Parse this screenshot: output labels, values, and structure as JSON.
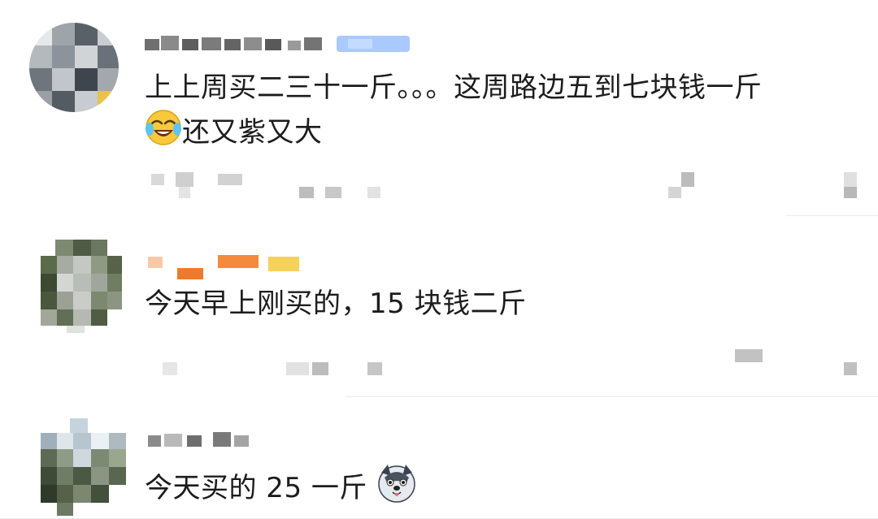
{
  "comments": [
    {
      "lines": [
        "上上周买二三十一斤。。。这周路边五到七块钱一斤",
        "还又紫又大"
      ],
      "emoji": "laughing-crying-emoji"
    },
    {
      "lines": [
        "今天早上刚买的，15 块钱二斤"
      ]
    },
    {
      "lines": [
        "今天买的 25 一斤"
      ],
      "emoji": "husky-dog-emoji"
    }
  ],
  "colors": {
    "text": "#1c1c1c",
    "badge_blue": "#9ec2ff",
    "badge_orange": "#f07a2c",
    "badge_yellow": "#f7c948",
    "mosaic_gray": "#d9d9d9"
  }
}
